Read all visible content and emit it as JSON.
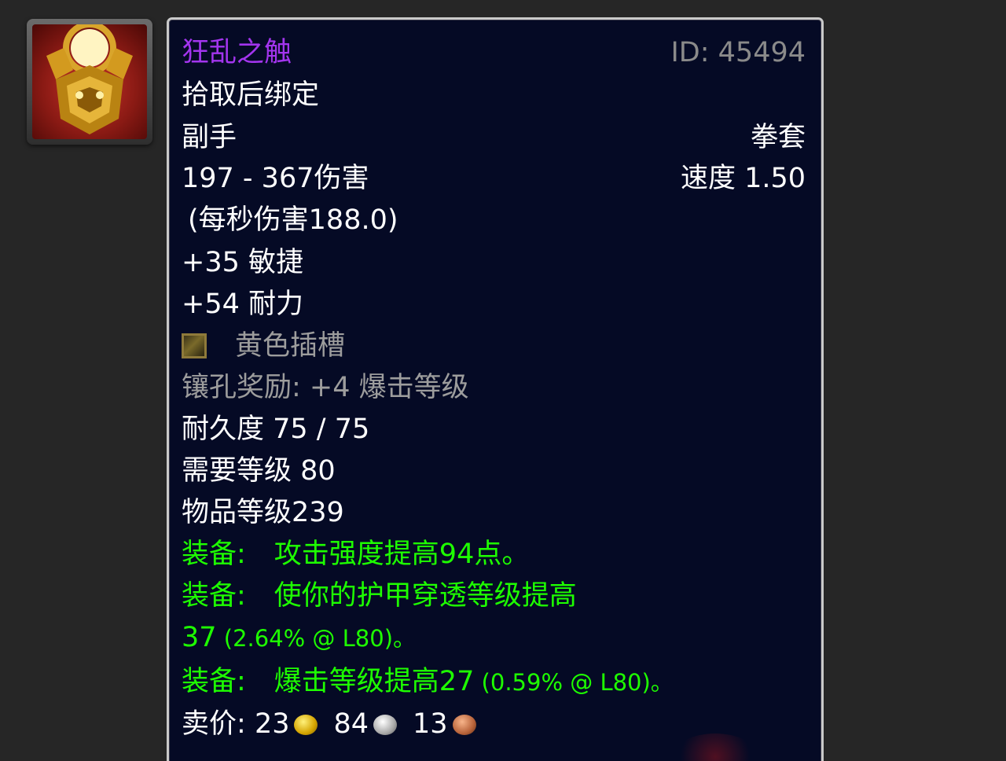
{
  "item": {
    "name": "狂乱之触",
    "id_label": "ID: 45494",
    "bind": "拾取后绑定",
    "slot": "副手",
    "type": "拳套",
    "damage": "197 - 367伤害",
    "speed": "速度 1.50",
    "dps": "(每秒伤害188.0)",
    "stats": [
      "+35 敏捷",
      "+54 耐力"
    ],
    "socket": {
      "icon": "yellow-socket-icon",
      "label": "黄色插槽"
    },
    "socket_bonus": "镶孔奖励: +4 爆击等级",
    "durability": "耐久度 75 / 75",
    "required_level": "需要等级 80",
    "item_level": "物品等级239",
    "equip": [
      {
        "prefix": "装备:",
        "text": "攻击强度提高94点。",
        "detail": ""
      },
      {
        "prefix": "装备:",
        "text": "使你的护甲穿透等级提高",
        "detail": ""
      },
      {
        "prefix": "",
        "text": "37",
        "detail": " (2.64% @ L80)。"
      },
      {
        "prefix": "装备:",
        "text": "爆击等级提高27",
        "detail": " (0.59% @ L80)。"
      }
    ],
    "sell_price": {
      "label": "卖价:",
      "gold": "23",
      "silver": "84",
      "copper": "13"
    }
  },
  "colors": {
    "epic": "#a335ee",
    "green": "#1eff00",
    "gray": "#9d9d9d",
    "tooltip_bg": "#050a25"
  },
  "icons": {
    "item": "gauntlet-item-icon",
    "gold": "gold-coin-icon",
    "silver": "silver-coin-icon",
    "copper": "copper-coin-icon"
  }
}
